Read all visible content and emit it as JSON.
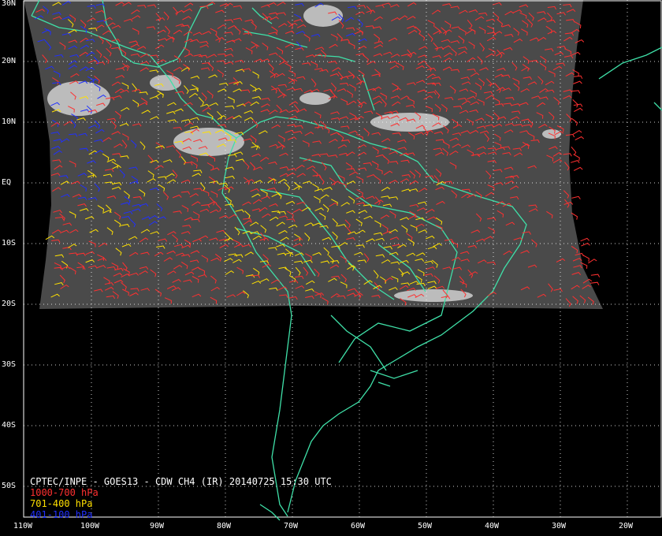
{
  "map": {
    "title": "CPTEC/INPE - GOES13 - CDW CH4 (IR) 20140725 15:30 UTC",
    "colors": {
      "background": "#000000",
      "coastline": "#3fe0a8",
      "grid": "#ffffff",
      "imagery": "#4a4a4a",
      "cloud": "#d8d8d8",
      "low_level": "#ff3030",
      "mid_level": "#ffe000",
      "high_level": "#2030ff"
    },
    "lat_labels": [
      "30N",
      "20N",
      "10N",
      "EQ",
      "10S",
      "20S",
      "30S",
      "40S",
      "50S"
    ],
    "lon_labels": [
      "110W",
      "100W",
      "90W",
      "80W",
      "70W",
      "60W",
      "50W",
      "40W",
      "30W",
      "20W"
    ],
    "legend": [
      {
        "label": "1000-700 hPa",
        "level": "low_level"
      },
      {
        "label": "701-400 hPa",
        "level": "mid_level"
      },
      {
        "label": "401-100 hPa",
        "level": "high_level"
      }
    ]
  }
}
